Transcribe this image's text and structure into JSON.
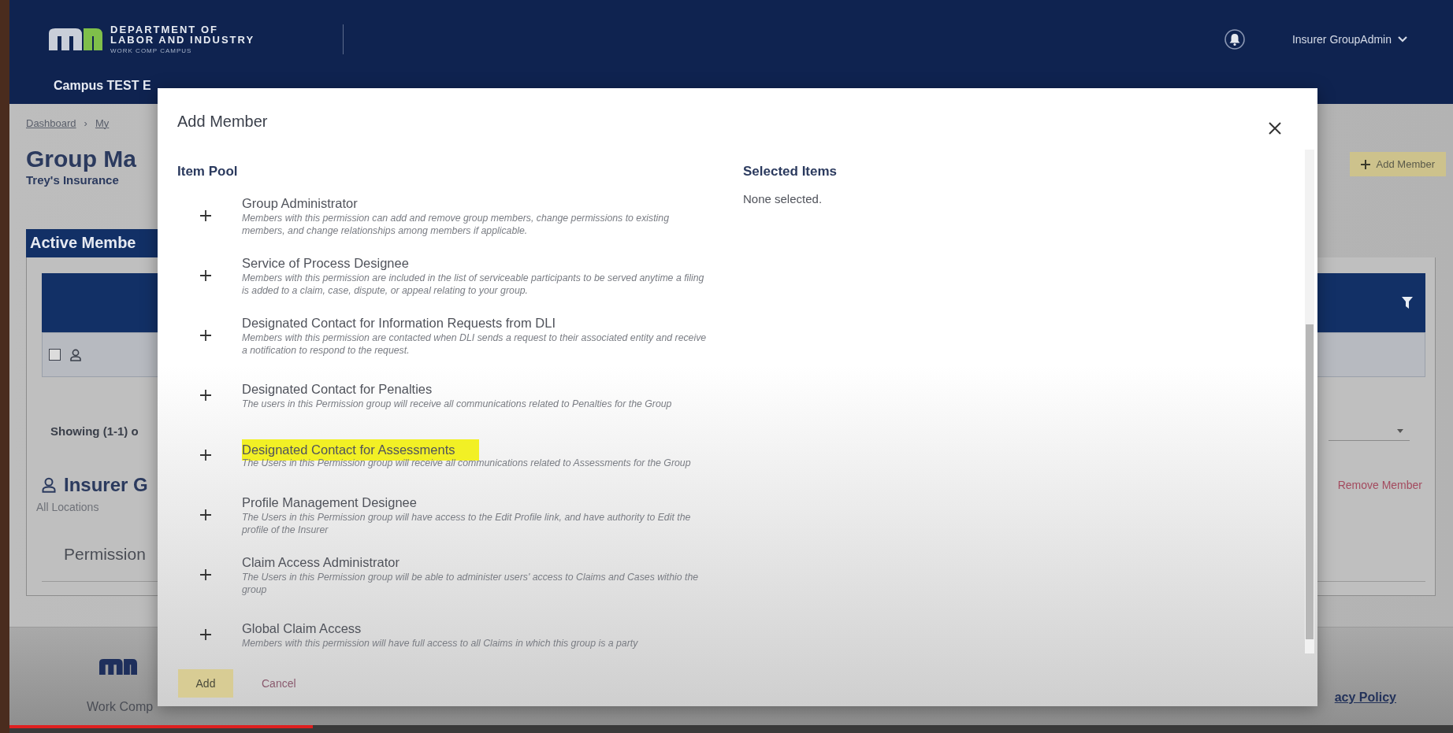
{
  "header": {
    "logo_lines": [
      "DEPARTMENT OF",
      "LABOR AND INDUSTRY",
      "WORK COMP CAMPUS"
    ],
    "environment": "Campus TEST E",
    "user": "Insurer GroupAdmin"
  },
  "breadcrumb": {
    "items": [
      "Dashboard",
      "My"
    ],
    "separator": "›"
  },
  "page": {
    "title": "Group Ma",
    "subtitle": "Trey's Insurance",
    "add_button": "Add Member"
  },
  "members_panel": {
    "title": "Active Membe",
    "row_checked": false,
    "showing": "Showing (1-1) o",
    "member_name": "Insurer G",
    "member_location": "All Locations",
    "remove_link": "Remove Member",
    "permissions_label": "Permission"
  },
  "footer": {
    "text": "Work Comp",
    "privacy_link": "acy Policy"
  },
  "modal": {
    "title": "Add Member",
    "item_pool_heading": "Item Pool",
    "selected_heading": "Selected Items",
    "selected_empty": "None selected.",
    "items": [
      {
        "title": "Group Administrator",
        "description": "Members with this permission can add and remove group members, change permissions to existing members, and change relationships among members if applicable.",
        "highlighted": false
      },
      {
        "title": "Service of Process Designee",
        "description": "Members with this permission are included in the list of serviceable participants to be served anytime a filing is added to a claim, case, dispute, or appeal relating to your group.",
        "highlighted": false
      },
      {
        "title": "Designated Contact for Information Requests from DLI",
        "description": "Members with this permission are contacted when DLI sends a request to their associated entity and receive a notification to respond to the request.",
        "highlighted": false
      },
      {
        "title": "Designated Contact for Penalties",
        "description": "The users in this Permission group will receive all communications related to Penalties for the Group",
        "highlighted": false
      },
      {
        "title": "Designated Contact for Assessments",
        "description": "The Users in this Permission group will receive all communications related to Assessments for the Group",
        "highlighted": true
      },
      {
        "title": "Profile Management Designee",
        "description": "The Users in this Permission group will have access to the Edit Profile link, and have authority to Edit the profile of the Insurer",
        "highlighted": false
      },
      {
        "title": "Claim Access Administrator",
        "description": "The Users in this Permission group will be able to administer users' access to Claims and Cases withio the group",
        "highlighted": false
      },
      {
        "title": "Global Claim Access",
        "description": "Members with this permission will have full access to all Claims in which this group is a party",
        "highlighted": false
      }
    ],
    "buttons": {
      "add": "Add",
      "cancel": "Cancel"
    }
  },
  "video_progress": {
    "level": 0.21
  }
}
